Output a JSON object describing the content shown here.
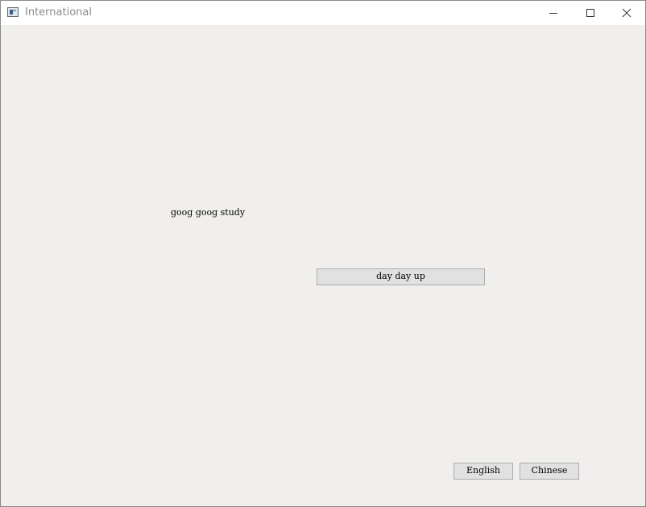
{
  "window": {
    "title": "International"
  },
  "titlebar": {
    "icons": {
      "app": "app-window-icon",
      "minimize": "minimize-icon",
      "maximize": "maximize-icon",
      "close": "close-icon"
    }
  },
  "main": {
    "label_text": "goog goog study",
    "action_button_label": "day day up"
  },
  "language": {
    "english_label": "English",
    "chinese_label": "Chinese"
  },
  "colors": {
    "window_bg": "#f0efed",
    "button_bg": "#e1e1e1",
    "button_border": "#adadad",
    "title_text": "#8c8c8c"
  }
}
